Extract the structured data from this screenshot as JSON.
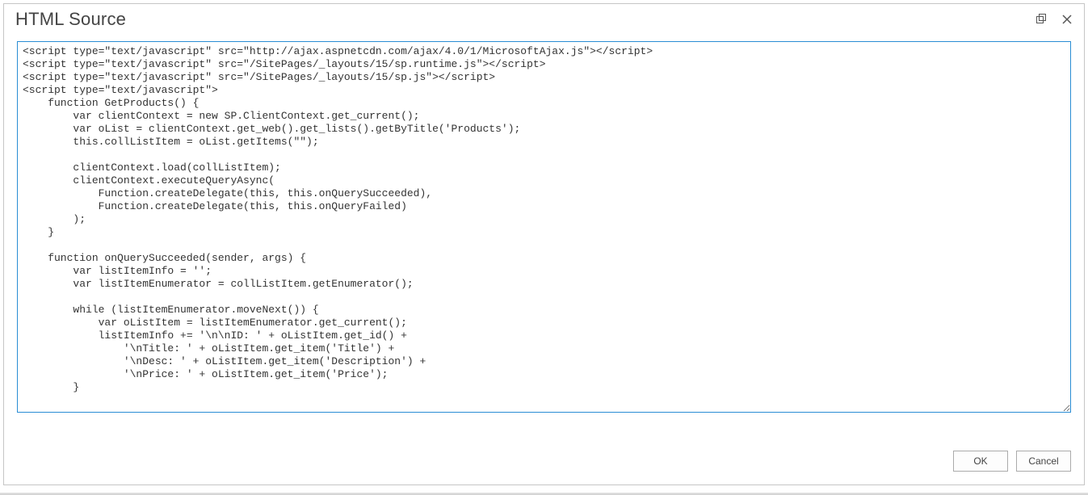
{
  "dialog": {
    "title": "HTML Source",
    "maximize_tooltip": "Maximize",
    "close_tooltip": "Close"
  },
  "editor": {
    "content": "<script type=\"text/javascript\" src=\"http://ajax.aspnetcdn.com/ajax/4.0/1/MicrosoftAjax.js\"></script>\n<script type=\"text/javascript\" src=\"/SitePages/_layouts/15/sp.runtime.js\"></script>\n<script type=\"text/javascript\" src=\"/SitePages/_layouts/15/sp.js\"></script>\n<script type=\"text/javascript\">\n    function GetProducts() {\n        var clientContext = new SP.ClientContext.get_current();\n        var oList = clientContext.get_web().get_lists().getByTitle('Products');\n        this.collListItem = oList.getItems(\"\");\n\n        clientContext.load(collListItem);\n        clientContext.executeQueryAsync(\n            Function.createDelegate(this, this.onQuerySucceeded),\n            Function.createDelegate(this, this.onQueryFailed)\n        );\n    }\n\n    function onQuerySucceeded(sender, args) {\n        var listItemInfo = '';\n        var listItemEnumerator = collListItem.getEnumerator();\n\n        while (listItemEnumerator.moveNext()) {\n            var oListItem = listItemEnumerator.get_current();\n            listItemInfo += '\\n\\nID: ' + oListItem.get_id() +\n                '\\nTitle: ' + oListItem.get_item('Title') +\n                '\\nDesc: ' + oListItem.get_item('Description') +\n                '\\nPrice: ' + oListItem.get_item('Price');\n        }\n"
  },
  "footer": {
    "ok_label": "OK",
    "cancel_label": "Cancel"
  }
}
